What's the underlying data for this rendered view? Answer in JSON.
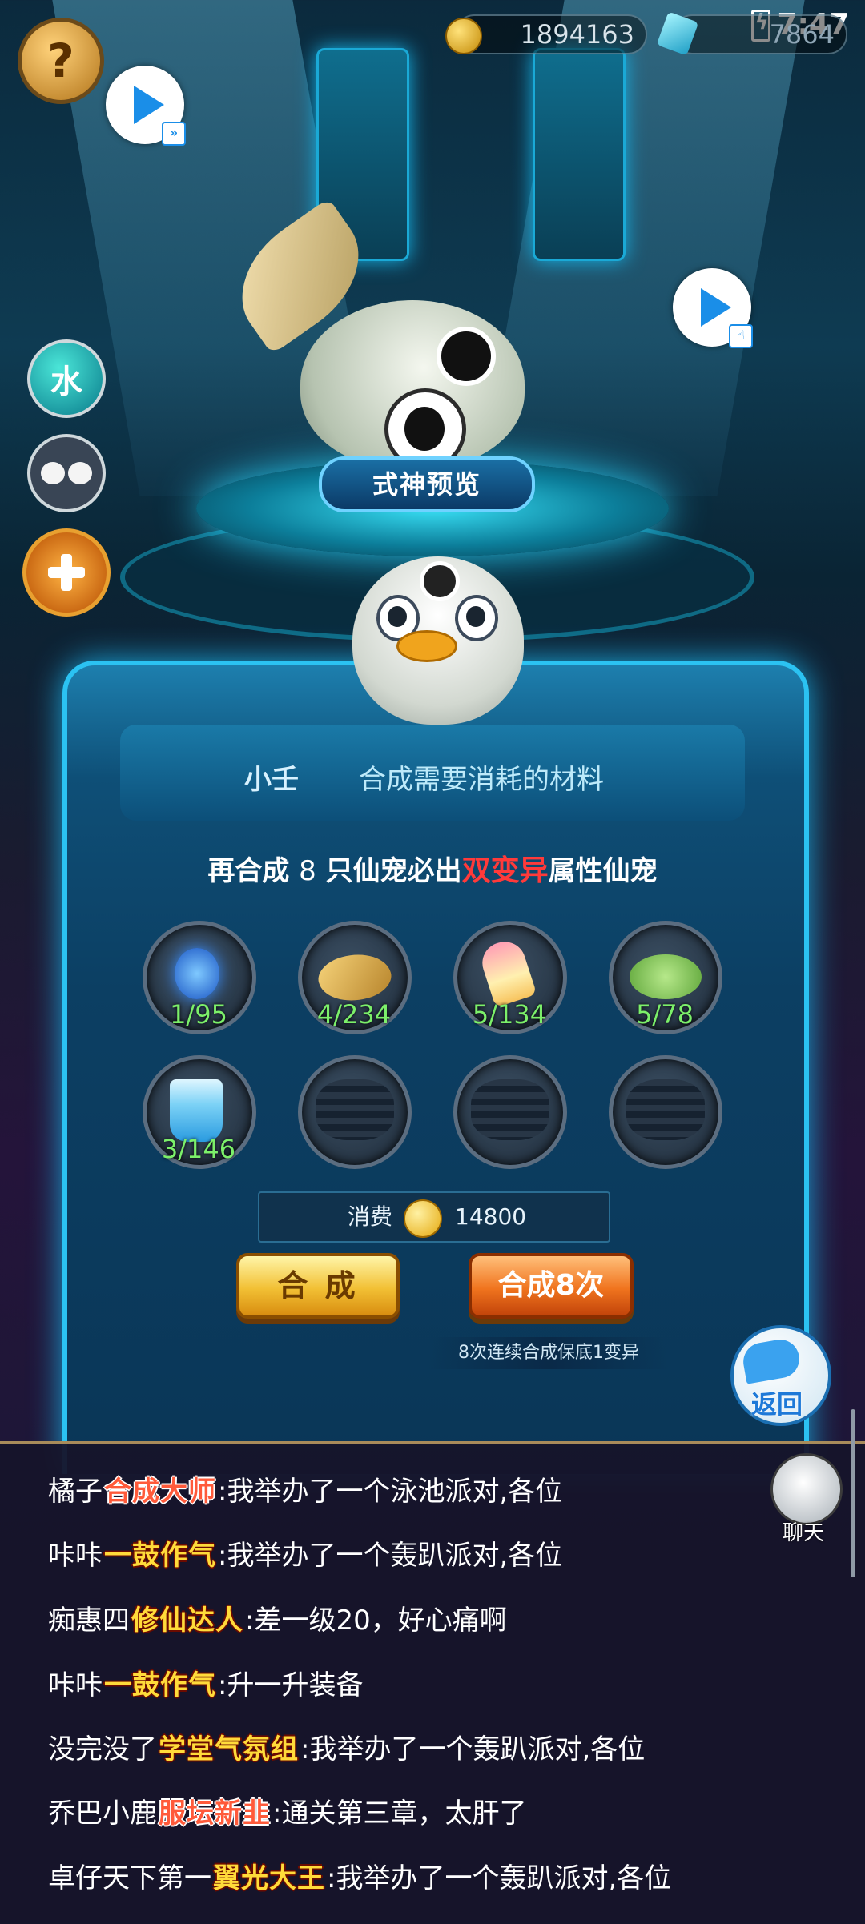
{
  "status_bar": {
    "time": "7:47"
  },
  "currency": {
    "gold": "1894163",
    "gems": "7864"
  },
  "pet_preview": {
    "label": "式神预览"
  },
  "side_buttons": {
    "water_label": "水"
  },
  "panel": {
    "pet_name": "小壬",
    "materials_title": "合成需要消耗的材料",
    "hint_prefix": "再合成",
    "hint_count": "8",
    "hint_middle": "只仙宠必出",
    "hint_highlight": "双变异",
    "hint_suffix": "属性仙宠",
    "materials": [
      {
        "icon": "blue-soul-icon",
        "count": "1/95"
      },
      {
        "icon": "leaf-icon",
        "count": "4/234"
      },
      {
        "icon": "popsicle-icon",
        "count": "5/134"
      },
      {
        "icon": "lily-pad-icon",
        "count": "5/78"
      },
      {
        "icon": "water-cup-icon",
        "count": "3/146"
      }
    ],
    "cost_label": "消费",
    "cost_value": "14800",
    "synth_once_label": "合 成",
    "synth_eight_label": "合成8次",
    "guarantee_text": "8次连续合成保底1变异",
    "back_label": "返回"
  },
  "chat": {
    "button_label": "聊天",
    "messages": [
      {
        "name": "橘子",
        "title": "合成大师",
        "text": ":我举办了一个泳池派对,各位"
      },
      {
        "name": "咔咔",
        "title": "一鼓作气",
        "text": ":我举办了一个轰趴派对,各位"
      },
      {
        "name": "痴惠四",
        "title": "修仙达人",
        "text": ":差一级20，好心痛啊"
      },
      {
        "name": "咔咔",
        "title": "一鼓作气",
        "text": ":升一升装备"
      },
      {
        "name": "没完没了",
        "title": "学堂气氛组",
        "text": ":我举办了一个轰趴派对,各位"
      },
      {
        "name": "乔巴小鹿",
        "title": "服坛新韭",
        "text": ":通关第三章，太肝了"
      },
      {
        "name": "卓仔天下第一",
        "title": "翼光大王",
        "text": ":我举办了一个轰趴派对,各位"
      }
    ]
  }
}
